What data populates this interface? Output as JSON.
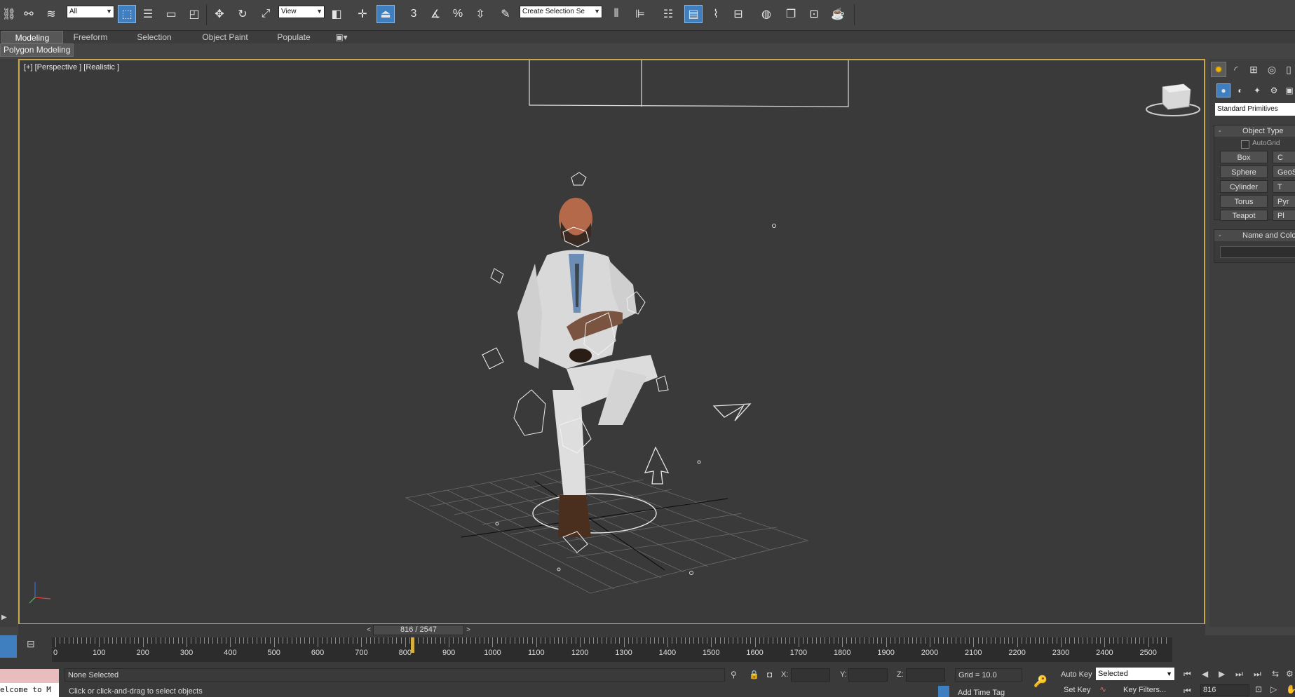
{
  "toolbar": {
    "selection_filter": "All",
    "ref_coord": "View",
    "named_selection": "Create Selection Se",
    "snap_3d_label": "3"
  },
  "ribbon": {
    "tabs": [
      "Modeling",
      "Freeform",
      "Selection",
      "Object Paint",
      "Populate"
    ],
    "active_tab": "Modeling",
    "panel_label": "Polygon Modeling"
  },
  "viewport": {
    "label": "[+] [Perspective ] [Realistic ]"
  },
  "command_panel": {
    "category": "Standard Primitives",
    "object_type_title": "Object Type",
    "autogrid_label": "AutoGrid",
    "buttons": [
      "Box",
      "Sphere",
      "Cylinder",
      "Torus",
      "Teapot"
    ],
    "buttons_col2": [
      "C",
      "GeoS",
      "T",
      "Pyr",
      "Pl"
    ],
    "name_color_title": "Name and Color"
  },
  "timeline": {
    "frame_display": "816 / 2547",
    "current_frame": 816,
    "total_frames": 2547,
    "ruler_max": 2547,
    "tick_labels": [
      "0",
      "100",
      "200",
      "300",
      "400",
      "500",
      "600",
      "700",
      "800",
      "900",
      "1000",
      "1100",
      "1200",
      "1300",
      "1400",
      "1500",
      "1600",
      "1700",
      "1800",
      "1900",
      "2000",
      "2100",
      "2200",
      "2300",
      "2400",
      "2500"
    ]
  },
  "status": {
    "maxscript_text": "elcome to M",
    "selection_status": "None Selected",
    "prompt": "Click or click-and-drag to select objects",
    "x_label": "X:",
    "y_label": "Y:",
    "z_label": "Z:",
    "grid": "Grid = 10.0",
    "add_time_tag": "Add Time Tag",
    "auto_key": "Auto Key",
    "set_key": "Set Key",
    "key_mode": "Selected",
    "key_filters": "Key Filters...",
    "frame_field": "816"
  }
}
